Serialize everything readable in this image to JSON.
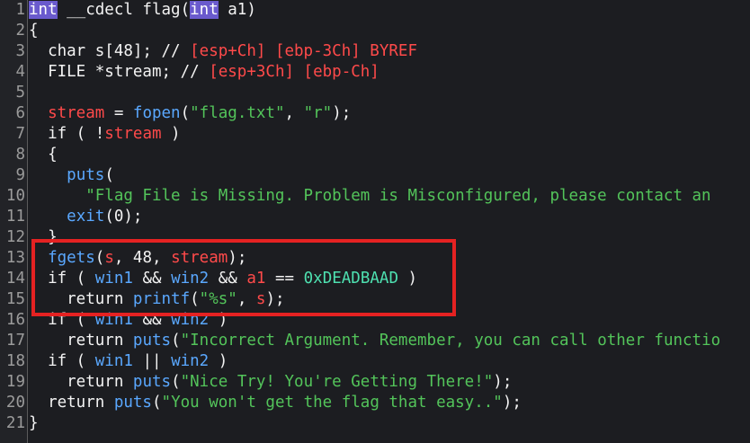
{
  "lines": [
    {
      "n": "1",
      "parts": [
        [
          "int",
          "purple-bg"
        ],
        [
          " __cdecl flag(",
          "white"
        ],
        [
          "int",
          "purple-bg"
        ],
        [
          " a1)",
          "white"
        ]
      ]
    },
    {
      "n": "2",
      "parts": [
        [
          "{",
          "white"
        ]
      ]
    },
    {
      "n": "3",
      "parts": [
        [
          "  char s[48]; // ",
          "white"
        ],
        [
          "[esp+Ch] [ebp-3Ch] BYREF",
          "red"
        ]
      ]
    },
    {
      "n": "4",
      "parts": [
        [
          "  FILE *stream; // ",
          "white"
        ],
        [
          "[esp+3Ch] [ebp-Ch]",
          "red"
        ]
      ]
    },
    {
      "n": "5",
      "parts": [
        [
          "",
          "white"
        ]
      ]
    },
    {
      "n": "6",
      "parts": [
        [
          "  ",
          "white"
        ],
        [
          "stream",
          "red"
        ],
        [
          " = ",
          "white"
        ],
        [
          "fopen",
          "blue"
        ],
        [
          "(",
          "white"
        ],
        [
          "\"flag.txt\"",
          "green"
        ],
        [
          ", ",
          "white"
        ],
        [
          "\"r\"",
          "green"
        ],
        [
          ");",
          "white"
        ]
      ]
    },
    {
      "n": "7",
      "parts": [
        [
          "  if ( !",
          "white"
        ],
        [
          "stream",
          "red"
        ],
        [
          " )",
          "white"
        ]
      ]
    },
    {
      "n": "8",
      "parts": [
        [
          "  {",
          "white"
        ]
      ]
    },
    {
      "n": "9",
      "parts": [
        [
          "    ",
          "white"
        ],
        [
          "puts",
          "blue"
        ],
        [
          "(",
          "white"
        ]
      ]
    },
    {
      "n": "10",
      "parts": [
        [
          "      ",
          "white"
        ],
        [
          "\"Flag File is Missing. Problem is Misconfigured, please contact an",
          "green"
        ]
      ]
    },
    {
      "n": "11",
      "parts": [
        [
          "    ",
          "white"
        ],
        [
          "exit",
          "blue"
        ],
        [
          "(0);",
          "white"
        ]
      ]
    },
    {
      "n": "12",
      "parts": [
        [
          "  }",
          "white"
        ]
      ]
    },
    {
      "n": "13",
      "parts": [
        [
          "  ",
          "white"
        ],
        [
          "fgets",
          "blue"
        ],
        [
          "(",
          "white"
        ],
        [
          "s",
          "red"
        ],
        [
          ", 48, ",
          "white"
        ],
        [
          "stream",
          "red"
        ],
        [
          ");",
          "white"
        ]
      ]
    },
    {
      "n": "14",
      "parts": [
        [
          "  if ( ",
          "white"
        ],
        [
          "win1",
          "blue"
        ],
        [
          " && ",
          "white"
        ],
        [
          "win2",
          "blue"
        ],
        [
          " && ",
          "white"
        ],
        [
          "a1",
          "red"
        ],
        [
          " == ",
          "white"
        ],
        [
          "0xDEADBAAD",
          "hex"
        ],
        [
          " )",
          "white"
        ]
      ]
    },
    {
      "n": "15",
      "parts": [
        [
          "    return ",
          "white"
        ],
        [
          "printf",
          "blue"
        ],
        [
          "(",
          "white"
        ],
        [
          "\"%s\"",
          "green"
        ],
        [
          ", ",
          "white"
        ],
        [
          "s",
          "red"
        ],
        [
          ");",
          "white"
        ]
      ]
    },
    {
      "n": "16",
      "parts": [
        [
          "  if ( ",
          "white"
        ],
        [
          "win1",
          "blue"
        ],
        [
          " && ",
          "white"
        ],
        [
          "win2",
          "blue"
        ],
        [
          " )",
          "white"
        ]
      ]
    },
    {
      "n": "17",
      "parts": [
        [
          "    return ",
          "white"
        ],
        [
          "puts",
          "blue"
        ],
        [
          "(",
          "white"
        ],
        [
          "\"Incorrect Argument. Remember, you can call other functio",
          "green"
        ]
      ]
    },
    {
      "n": "18",
      "parts": [
        [
          "  if ( ",
          "white"
        ],
        [
          "win1",
          "blue"
        ],
        [
          " || ",
          "white"
        ],
        [
          "win2",
          "blue"
        ],
        [
          " )",
          "white"
        ]
      ]
    },
    {
      "n": "19",
      "parts": [
        [
          "    return ",
          "white"
        ],
        [
          "puts",
          "blue"
        ],
        [
          "(",
          "white"
        ],
        [
          "\"Nice Try! You're Getting There!\"",
          "green"
        ],
        [
          ");",
          "white"
        ]
      ]
    },
    {
      "n": "20",
      "parts": [
        [
          "  return ",
          "white"
        ],
        [
          "puts",
          "blue"
        ],
        [
          "(",
          "white"
        ],
        [
          "\"You won't get the flag that easy..\"",
          "green"
        ],
        [
          ");",
          "white"
        ]
      ]
    },
    {
      "n": "21",
      "parts": [
        [
          "}",
          "white"
        ]
      ]
    }
  ],
  "colors": {
    "background": "#1c1d21",
    "highlight_border": "#e52222",
    "keyword_bg": "#6a5acd",
    "function": "#5aa8ff",
    "variable": "#ff4a4a",
    "string": "#53c45a",
    "hex": "#4ee0b0"
  }
}
